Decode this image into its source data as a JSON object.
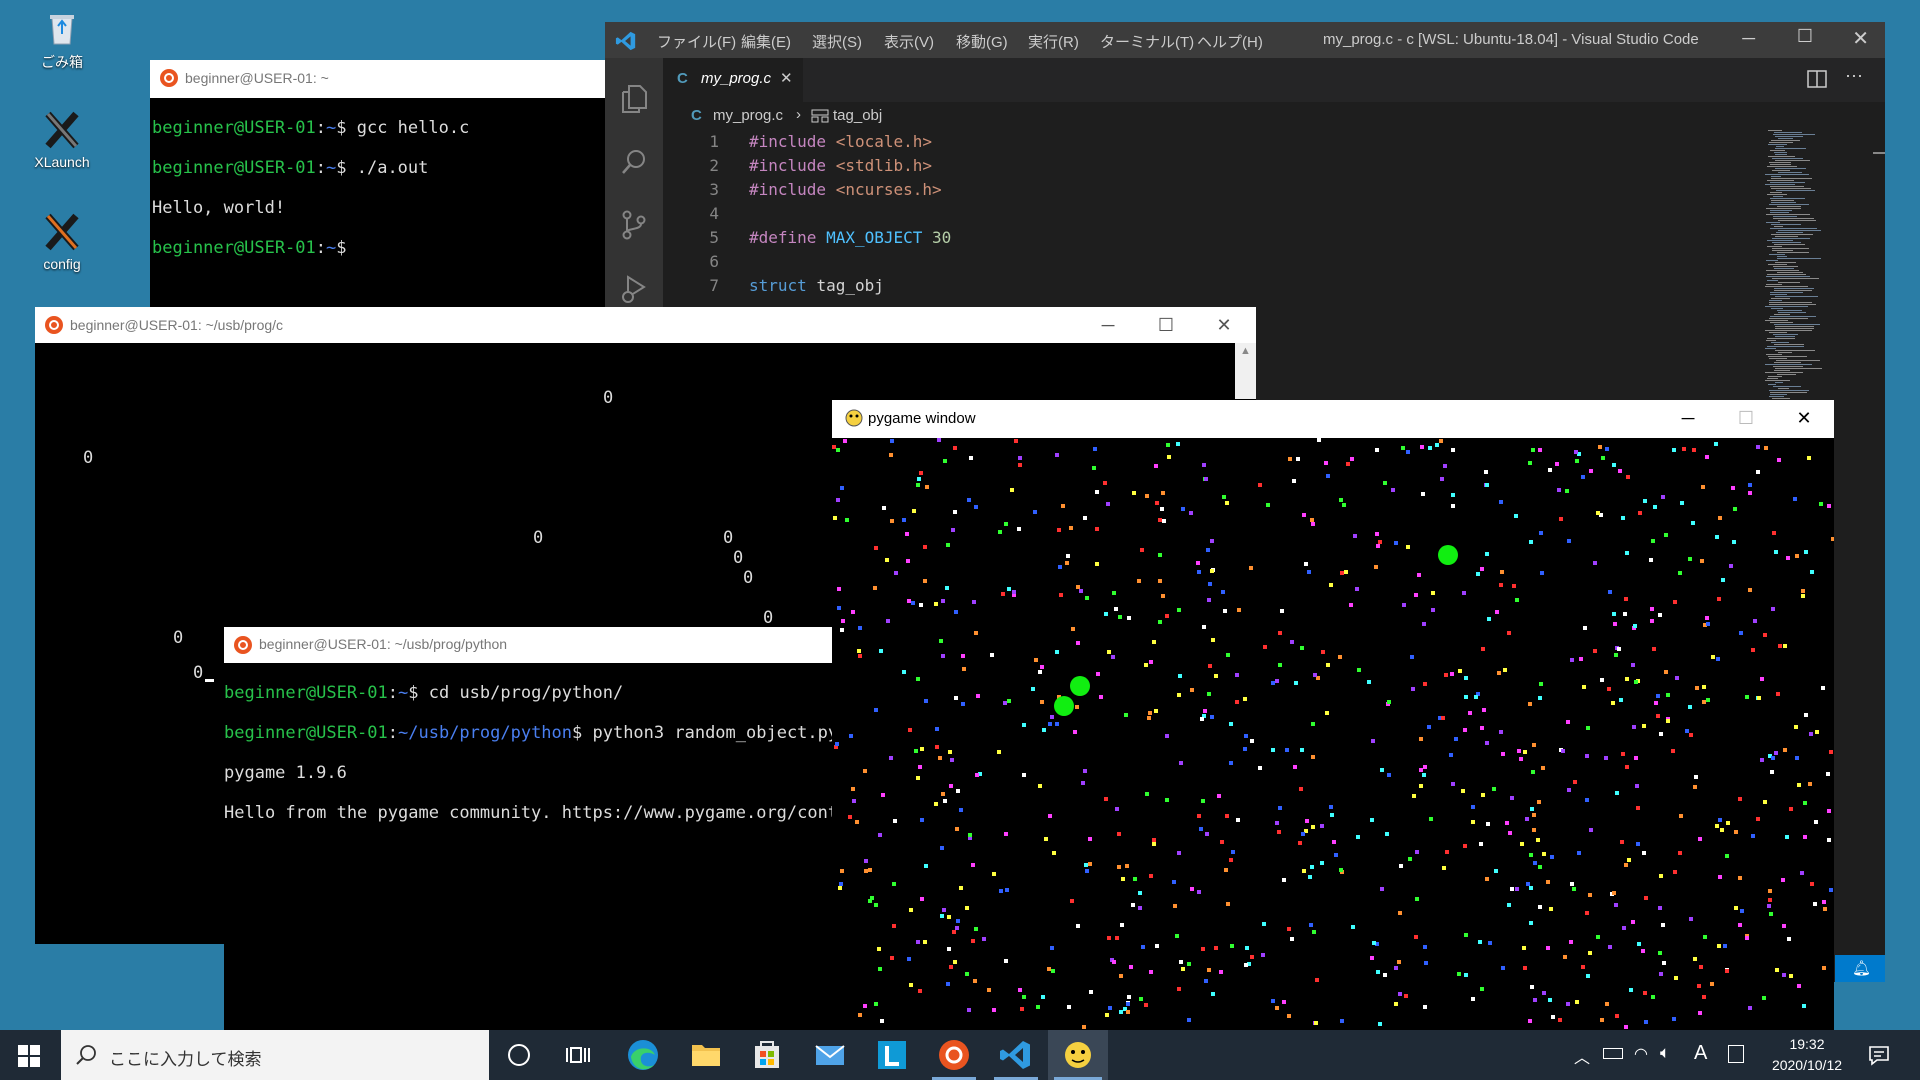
{
  "desktop": {
    "icons": [
      {
        "label": "ごみ箱",
        "icon": "recycle-bin"
      },
      {
        "label": "XLaunch",
        "icon": "xlaunch"
      },
      {
        "label": "config",
        "icon": "xlaunch-config"
      }
    ]
  },
  "term_home": {
    "title": "beginner@USER-01: ~",
    "lines": [
      {
        "prompt": "beginner@USER-01",
        "path": "~",
        "cmd": "$ gcc hello.c"
      },
      {
        "prompt": "beginner@USER-01",
        "path": "~",
        "cmd": "$ ./a.out"
      },
      {
        "output": "Hello, world!"
      },
      {
        "prompt": "beginner@USER-01",
        "path": "~",
        "cmd": "$"
      }
    ]
  },
  "vscode": {
    "title": "my_prog.c - c [WSL: Ubuntu-18.04] - Visual Studio Code",
    "menu": [
      "ファイル(F)",
      "編集(E)",
      "選択(S)",
      "表示(V)",
      "移動(G)",
      "実行(R)",
      "ターミナル(T)",
      "ヘルプ(H)"
    ],
    "tab": {
      "label": "my_prog.c",
      "lang": "C"
    },
    "breadcrumb": {
      "file": "my_prog.c",
      "symbol": "tag_obj"
    },
    "code": [
      {
        "n": "1",
        "text": "#include <locale.h>"
      },
      {
        "n": "2",
        "text": "#include <stdlib.h>"
      },
      {
        "n": "3",
        "text": "#include <ncurses.h>"
      },
      {
        "n": "4",
        "text": ""
      },
      {
        "n": "5",
        "text": "#define MAX_OBJECT 30"
      },
      {
        "n": "6",
        "text": ""
      },
      {
        "n": "7",
        "text": "struct tag_obj"
      }
    ],
    "colors": {
      "bg": "#1e1e1e",
      "menubar": "#3c3c3c",
      "activitybar": "#333333",
      "accent": "#007acc"
    }
  },
  "term_c": {
    "title": "beginner@USER-01: ~/usb/prog/c",
    "zeros": [
      "0",
      "0",
      "0",
      "0",
      "0",
      "0",
      "0",
      "0",
      "0"
    ]
  },
  "term_py": {
    "title": "beginner@USER-01: ~/usb/prog/python",
    "lines": [
      {
        "prompt": "beginner@USER-01",
        "path": "~",
        "cmd": "$ cd usb/prog/python/"
      },
      {
        "prompt": "beginner@USER-01",
        "path": "~/usb/prog/python",
        "cmd": "$ python3 random_object.py"
      },
      {
        "output": "pygame 1.9.6"
      },
      {
        "output": "Hello from the pygame community. https://www.pygame.org/contr"
      }
    ]
  },
  "pygame": {
    "title": "pygame window",
    "green_circles": 3,
    "particle_colors": [
      "#ff3030",
      "#30ff30",
      "#3060ff",
      "#ffff40",
      "#ff40ff",
      "#40ffff",
      "#ffffff",
      "#ff9030",
      "#a040ff"
    ]
  },
  "taskbar": {
    "search_placeholder": "ここに入力して検索",
    "time": "19:32",
    "date": "2020/10/12",
    "ime": "A"
  }
}
